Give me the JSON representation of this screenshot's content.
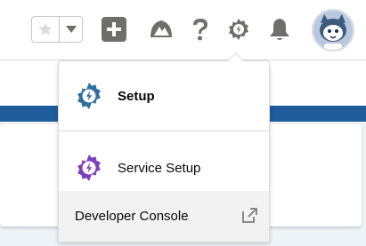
{
  "header": {
    "favorites_icon": "star-icon",
    "favorites_menu_icon": "chevron-down-icon",
    "global_actions_icon": "plus-icon",
    "trailhead_icon": "trailhead-icon",
    "help_icon": "question-icon",
    "setup_icon": "gear-icon",
    "notifications_icon": "bell-icon",
    "avatar_icon": "astro-avatar"
  },
  "setup_menu": {
    "items": [
      {
        "label": "Setup",
        "icon": "setup-gear-icon",
        "color": "#2f6f9f"
      },
      {
        "label": "Service Setup",
        "icon": "service-gear-icon",
        "color": "#7e3fbf"
      },
      {
        "label": "Developer Console",
        "icon": "external-link-icon"
      }
    ]
  },
  "colors": {
    "brand_band": "#1f5c9c",
    "icon_gray": "#706e6b"
  }
}
